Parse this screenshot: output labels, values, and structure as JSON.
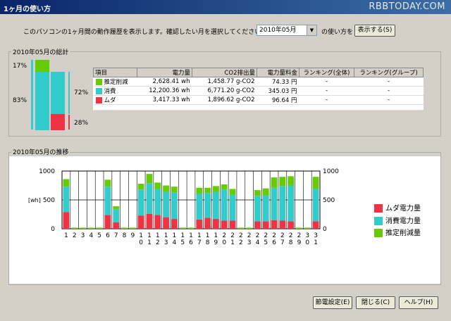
{
  "window": {
    "title": "1ヶ月の使い方",
    "watermark": "RBBTODAY.COM"
  },
  "header": {
    "intro": "このパソコンの1ヶ月間の動作履歴を表示します。確認したい月を選択してください。",
    "month_value": "2010年05月",
    "howto_label": "の使い方を",
    "show_button": "表示する(S)"
  },
  "summary": {
    "group_title": "2010年05月の総計",
    "left_top_pct": "17%",
    "left_bottom_pct": "83%",
    "right_top_pct": "72%",
    "right_bottom_pct": "28%",
    "columns": [
      "項目",
      "電力量",
      "CO2排出量",
      "電力量料金",
      "ランキング(全体)",
      "ランキング(グループ)"
    ],
    "rows": [
      {
        "color": "#66cc00",
        "label": "推定削減",
        "power": "2,628.41 wh",
        "co2": "1,458.77 g-CO2",
        "cost": "74.33 円",
        "rank_all": "-",
        "rank_group": "-"
      },
      {
        "color": "#33cccc",
        "label": "消費",
        "power": "12,200.36 wh",
        "co2": "6,771.20 g-CO2",
        "cost": "345.03 円",
        "rank_all": "-",
        "rank_group": "-"
      },
      {
        "color": "#ee3344",
        "label": "ムダ",
        "power": "3,417.33 wh",
        "co2": "1,896.62 g-CO2",
        "cost": "96.64 円",
        "rank_all": "-",
        "rank_group": "-"
      }
    ]
  },
  "trend": {
    "group_title": "2010年05月の推移",
    "legend": [
      {
        "label": "ムダ電力量",
        "color": "#ee3344"
      },
      {
        "label": "消費電力量",
        "color": "#33cccc"
      },
      {
        "label": "推定削減量",
        "color": "#66cc00"
      }
    ]
  },
  "chart_data": {
    "type": "bar",
    "stacked": true,
    "ylabel": "[wh]",
    "ylim": [
      0,
      1000
    ],
    "yticks": [
      0,
      500,
      1000
    ],
    "categories": [
      "1",
      "2",
      "3",
      "4",
      "5",
      "6",
      "7",
      "8",
      "9",
      "10",
      "11",
      "12",
      "13",
      "14",
      "15",
      "16",
      "17",
      "18",
      "19",
      "20",
      "21",
      "22",
      "23",
      "24",
      "25",
      "26",
      "27",
      "28",
      "29",
      "30",
      "31"
    ],
    "series": [
      {
        "name": "ムダ電力量",
        "color": "#ee3344",
        "values": [
          290,
          0,
          0,
          0,
          0,
          240,
          110,
          0,
          0,
          230,
          260,
          240,
          200,
          170,
          0,
          0,
          160,
          190,
          170,
          140,
          140,
          0,
          0,
          130,
          130,
          150,
          140,
          130,
          0,
          0,
          130
        ]
      },
      {
        "name": "消費電力量",
        "color": "#33cccc",
        "values": [
          440,
          0,
          0,
          0,
          0,
          490,
          230,
          0,
          0,
          450,
          530,
          450,
          440,
          460,
          0,
          0,
          450,
          430,
          470,
          540,
          450,
          0,
          0,
          440,
          450,
          560,
          600,
          620,
          0,
          0,
          560
        ]
      },
      {
        "name": "推定削減量",
        "color": "#66cc00",
        "values": [
          130,
          20,
          20,
          20,
          20,
          120,
          50,
          20,
          20,
          100,
          160,
          110,
          110,
          100,
          20,
          20,
          100,
          90,
          100,
          90,
          100,
          20,
          20,
          100,
          120,
          180,
          160,
          160,
          20,
          20,
          210
        ]
      }
    ]
  },
  "footer": {
    "power_settings": "節電設定(E)",
    "close": "閉じる(C)",
    "help": "ヘルプ(H)"
  }
}
